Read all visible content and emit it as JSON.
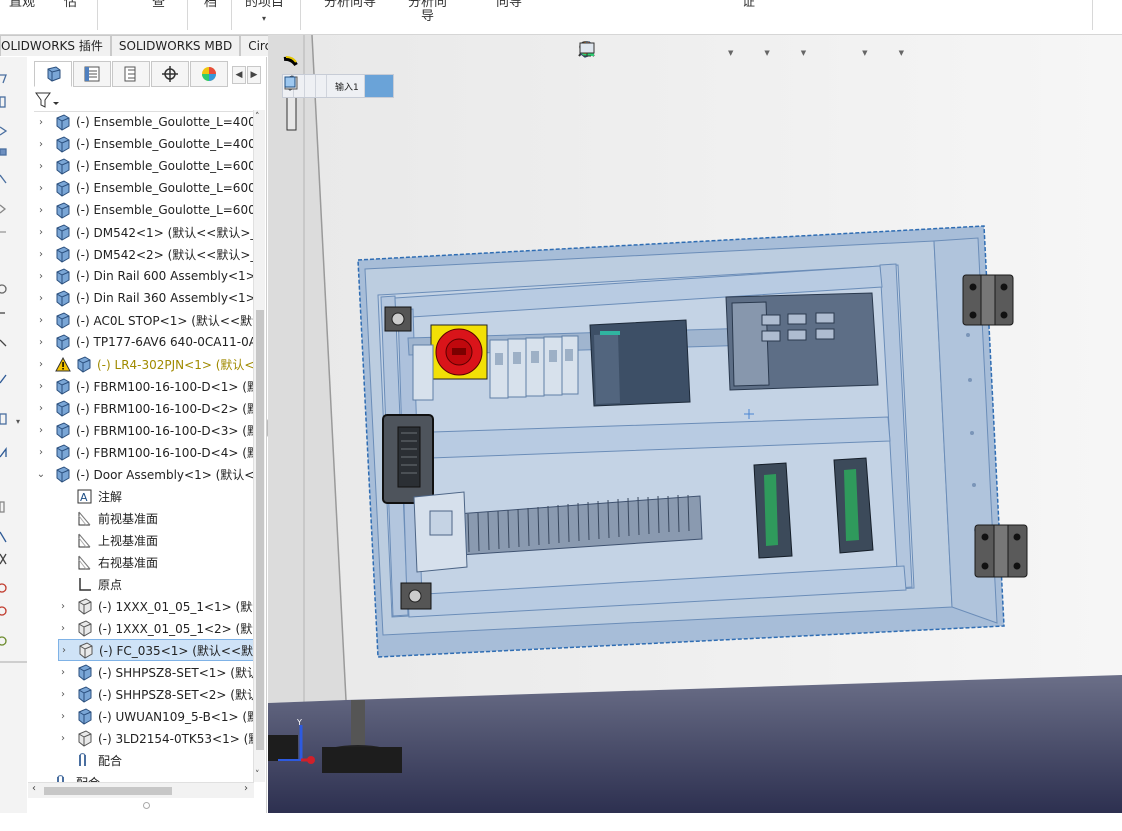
{
  "ribbon": {
    "items": [
      "直观",
      "估",
      "查",
      "档",
      "的项目",
      "分析向导",
      "分析向\n导",
      "向导",
      "证"
    ]
  },
  "command_tabs": [
    "OLIDWORKS 插件",
    "SOLIDWORKS MBD",
    "CircuitWorks"
  ],
  "feature_manager": {
    "tabs": [
      "feature-manager-tab",
      "property-manager-tab",
      "configuration-manager-tab",
      "dimxpert-tab",
      "display-manager-tab"
    ],
    "tree": [
      {
        "text": "(-) Ensemble_Goulotte_L=400-",
        "icon": "assembly-icon",
        "expander": "›"
      },
      {
        "text": "(-) Ensemble_Goulotte_L=400-",
        "icon": "assembly-icon",
        "expander": "›"
      },
      {
        "text": "(-) Ensemble_Goulotte_L=600-",
        "icon": "assembly-icon",
        "expander": "›"
      },
      {
        "text": "(-) Ensemble_Goulotte_L=600-",
        "icon": "assembly-icon",
        "expander": "›"
      },
      {
        "text": "(-) Ensemble_Goulotte_L=600-",
        "icon": "assembly-icon",
        "expander": "›"
      },
      {
        "text": "(-) DM542<1> (默认<<默认>_",
        "icon": "assembly-icon",
        "expander": "›"
      },
      {
        "text": "(-) DM542<2> (默认<<默认>_",
        "icon": "assembly-icon",
        "expander": "›"
      },
      {
        "text": "(-) Din Rail 600 Assembly<1>",
        "icon": "assembly-icon",
        "expander": "›"
      },
      {
        "text": "(-) Din Rail 360 Assembly<1>",
        "icon": "assembly-icon",
        "expander": "›"
      },
      {
        "text": "(-) AC0L STOP<1> (默认<<默认",
        "icon": "assembly-icon",
        "expander": "›"
      },
      {
        "text": "(-) TP177-6AV6 640-0CA11-0A",
        "icon": "assembly-icon",
        "expander": "›"
      },
      {
        "text": "(-) LR4-302PJN<1> (默认<",
        "icon": "assembly-icon",
        "expander": "›",
        "warning": true
      },
      {
        "text": "(-) FBRM100-16-100-D<1> (默",
        "icon": "assembly-icon",
        "expander": "›"
      },
      {
        "text": "(-) FBRM100-16-100-D<2> (默",
        "icon": "assembly-icon",
        "expander": "›"
      },
      {
        "text": "(-) FBRM100-16-100-D<3> (默",
        "icon": "assembly-icon",
        "expander": "›"
      },
      {
        "text": "(-) FBRM100-16-100-D<4> (默",
        "icon": "assembly-icon",
        "expander": "›"
      },
      {
        "text": "(-) Door Assembly<1> (默认<",
        "icon": "assembly-icon",
        "expander": "⌄"
      },
      {
        "text": "注解",
        "icon": "annotation-icon",
        "expander": "",
        "indent": 1
      },
      {
        "text": "前视基准面",
        "icon": "plane-icon",
        "expander": "",
        "indent": 1
      },
      {
        "text": "上视基准面",
        "icon": "plane-icon",
        "expander": "",
        "indent": 1
      },
      {
        "text": "右视基准面",
        "icon": "plane-icon",
        "expander": "",
        "indent": 1
      },
      {
        "text": "原点",
        "icon": "origin-icon",
        "expander": "",
        "indent": 1
      },
      {
        "text": "(-) 1XXX_01_05_1<1> (默认",
        "icon": "part-icon",
        "expander": "›",
        "indent": 1
      },
      {
        "text": "(-) 1XXX_01_05_1<2> (默认",
        "icon": "part-icon",
        "expander": "›",
        "indent": 1
      },
      {
        "text": "(-) FC_035<1> (默认<<默认",
        "icon": "part-icon",
        "expander": "›",
        "indent": 1,
        "selected": true
      },
      {
        "text": "(-) SHHPSZ8-SET<1> (默认",
        "icon": "assembly-icon",
        "expander": "›",
        "indent": 1
      },
      {
        "text": "(-) SHHPSZ8-SET<2> (默认",
        "icon": "assembly-icon",
        "expander": "›",
        "indent": 1
      },
      {
        "text": "(-) UWUAN109_5-B<1> (默",
        "icon": "assembly-icon",
        "expander": "›",
        "indent": 1
      },
      {
        "text": "(-) 3LD2154-0TK53<1> (默",
        "icon": "part-icon",
        "expander": "›",
        "indent": 1
      },
      {
        "text": "配合",
        "icon": "mates-icon",
        "expander": "",
        "indent": 1
      },
      {
        "text": "配合",
        "icon": "mates-icon",
        "expander": "",
        "indent": 0
      }
    ]
  },
  "viewport": {
    "heads_up_icons": [
      "zoom-to-fit-icon",
      "zoom-area-icon",
      "previous-view-icon",
      "section-view-icon",
      "dynamic-annotation-icon",
      "view-orientation-icon",
      "display-style-icon",
      "hide-show-icon",
      "edit-appearance-icon",
      "apply-scene-icon",
      "view-settings-icon"
    ],
    "breadcrumb": {
      "label": "输入1",
      "icons": [
        "assembly-icon",
        "assembly-icon",
        "part-icon",
        "box-icon",
        "input-icon"
      ]
    }
  },
  "colors": {
    "selection_blue": "#7fb2e6",
    "panel_face": "#a9bfd9",
    "estop_red": "#d9141a",
    "estop_yellow": "#f2e006",
    "warning_yellow": "#a08a00",
    "floor": "#3f4260"
  }
}
